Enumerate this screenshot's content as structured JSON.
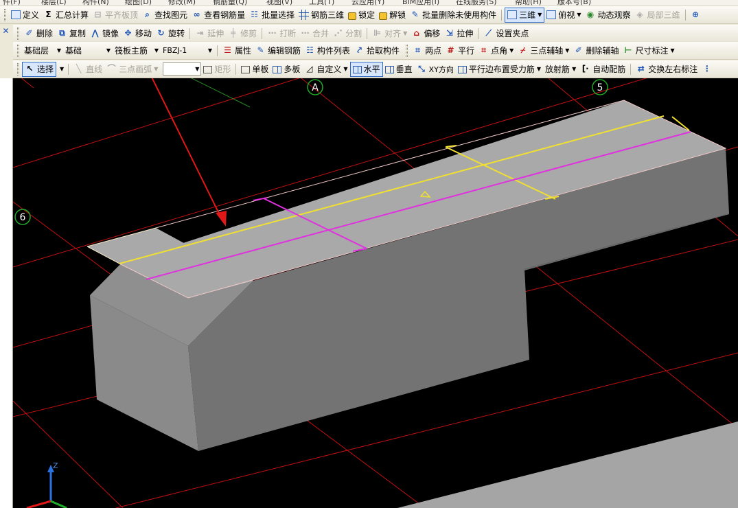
{
  "menu_strip": [
    "件(F)",
    "楼层(L)",
    "构件(N)",
    "绘图(D)",
    "修改(M)",
    "钢筋量(Q)",
    "视图(V)",
    "工具(T)",
    "云应用(Y)",
    "BIM应用(I)",
    "在线服务(S)",
    "帮助(H)",
    "版本号(B)"
  ],
  "toolbar1": {
    "define": "定义",
    "summary": "汇总计算",
    "align_top": "平齐板顶",
    "find_element": "查找图元",
    "view_rebar": "查看钢筋量",
    "batch_select": "批量选择",
    "rebar_3d": "钢筋三维",
    "lock": "锁定",
    "unlock": "解锁",
    "batch_delete": "批量删除未使用构件",
    "three_d": "三维",
    "top_view": "俯视",
    "orbit": "动态观察",
    "local_3d": "局部三维"
  },
  "toolbar2": {
    "delete": "删除",
    "copy": "复制",
    "mirror": "镜像",
    "move": "移动",
    "rotate": "旋转",
    "extend": "延伸",
    "trim": "修剪",
    "break": "打断",
    "merge": "合并",
    "split": "分割",
    "align": "对齐",
    "offset": "偏移",
    "stretch": "拉伸",
    "set_grip": "设置夹点"
  },
  "toolbar3": {
    "layer": "基础层",
    "category": "基础",
    "element_type": "筏板主筋",
    "element_name": "FBZJ-1",
    "properties": "属性",
    "edit_rebar": "编辑钢筋",
    "element_list": "构件列表",
    "pick_element": "拾取构件",
    "two_points": "两点",
    "parallel": "平行",
    "point_angle": "点角",
    "three_point_aux": "三点辅轴",
    "delete_aux": "删除辅轴",
    "dimension": "尺寸标注"
  },
  "toolbar4": {
    "select": "选择",
    "line": "直线",
    "arc": "三点画弧",
    "rect": "矩形",
    "single_slab": "单板",
    "multi_slab": "多板",
    "custom": "自定义",
    "horizontal": "水平",
    "vertical": "垂直",
    "xy_dir": "XY方向",
    "parallel_edge": "平行边布置受力筋",
    "radial": "放射筋",
    "auto_rebar": "自动配筋",
    "swap_label": "交换左右标注"
  },
  "viewport": {
    "axis_a": "A",
    "axis_5": "5",
    "axis_6": "6",
    "z_axis": "Z"
  },
  "colors": {
    "background": "#000000",
    "grid_line": "#c41010",
    "slab_top": "#a9a9a9",
    "slab_front": "#737373",
    "slab_side": "#8a8a8a",
    "rebar_x": "#f0e030",
    "rebar_y": "#e030e0",
    "pointer_arrow": "#e01818",
    "axis_badge": "#1fae2a"
  }
}
